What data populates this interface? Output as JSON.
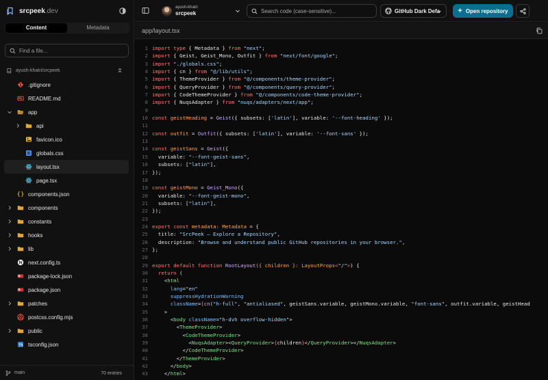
{
  "brand": {
    "name": "srcpeek",
    "tld": ".dev"
  },
  "sidebar": {
    "tabs": [
      {
        "label": "Content",
        "active": true
      },
      {
        "label": "Metadata",
        "active": false
      }
    ],
    "find_placeholder": "Find a file...",
    "repo_path": "ayush-khatri/srcpeek",
    "tree": [
      {
        "label": ".gitignore",
        "icon": "git-icon",
        "kind": "file",
        "indent": 0
      },
      {
        "label": "README.md",
        "icon": "markdown-icon",
        "kind": "file",
        "indent": 0
      },
      {
        "label": "app",
        "icon": "folder-open-icon",
        "kind": "folder-open",
        "indent": 0
      },
      {
        "label": "api",
        "icon": "folder-icon",
        "kind": "folder",
        "indent": 1
      },
      {
        "label": "favicon.ico",
        "icon": "image-icon",
        "kind": "file",
        "indent": 1
      },
      {
        "label": "globals.css",
        "icon": "css-icon",
        "kind": "file",
        "indent": 1
      },
      {
        "label": "layout.tsx",
        "icon": "react-icon",
        "kind": "file",
        "indent": 1,
        "selected": true
      },
      {
        "label": "page.tsx",
        "icon": "react-icon",
        "kind": "file",
        "indent": 1
      },
      {
        "label": "components.json",
        "icon": "json-icon",
        "kind": "file",
        "indent": 0
      },
      {
        "label": "components",
        "icon": "folder-icon",
        "kind": "folder",
        "indent": 0
      },
      {
        "label": "constants",
        "icon": "folder-icon",
        "kind": "folder",
        "indent": 0
      },
      {
        "label": "hooks",
        "icon": "folder-icon",
        "kind": "folder",
        "indent": 0
      },
      {
        "label": "lib",
        "icon": "folder-icon",
        "kind": "folder",
        "indent": 0
      },
      {
        "label": "next.config.ts",
        "icon": "next-icon",
        "kind": "file",
        "indent": 0
      },
      {
        "label": "package-lock.json",
        "icon": "npm-icon",
        "kind": "file",
        "indent": 0
      },
      {
        "label": "package.json",
        "icon": "npm-icon",
        "kind": "file",
        "indent": 0
      },
      {
        "label": "patches",
        "icon": "folder-icon",
        "kind": "folder",
        "indent": 0
      },
      {
        "label": "postcss.config.mjs",
        "icon": "postcss-icon",
        "kind": "file",
        "indent": 0
      },
      {
        "label": "public",
        "icon": "folder-icon",
        "kind": "folder",
        "indent": 0
      },
      {
        "label": "tsconfig.json",
        "icon": "tsconfig-icon",
        "kind": "file",
        "indent": 0
      }
    ],
    "status": {
      "branch": "main",
      "entries": "70 entries"
    }
  },
  "topbar": {
    "owner": "ayush-khatri",
    "repo": "srcpeek",
    "search_placeholder": "Search code (case-sensitive)...",
    "theme_value": "GitHub Dark Default",
    "open_repo_label": "Open repository"
  },
  "editor": {
    "path": "app/layout.tsx",
    "lines": [
      [
        [
          "kw",
          "import "
        ],
        [
          "kw",
          "type "
        ],
        [
          "txt",
          "{ Metadata } "
        ],
        [
          "kw",
          "from "
        ],
        [
          "str",
          "\"next\""
        ],
        [
          "txt",
          ";"
        ]
      ],
      [
        [
          "kw",
          "import "
        ],
        [
          "txt",
          "{ Geist, Geist_Mono, Outfit } "
        ],
        [
          "kw",
          "from "
        ],
        [
          "str",
          "\"next/font/google\""
        ],
        [
          "txt",
          ";"
        ]
      ],
      [
        [
          "kw",
          "import "
        ],
        [
          "str",
          "\"./globals.css\""
        ],
        [
          "txt",
          ";"
        ]
      ],
      [
        [
          "kw",
          "import "
        ],
        [
          "txt",
          "{ cn } "
        ],
        [
          "kw",
          "from "
        ],
        [
          "str",
          "\"@/lib/utils\""
        ],
        [
          "txt",
          ";"
        ]
      ],
      [
        [
          "kw",
          "import "
        ],
        [
          "txt",
          "{ ThemeProvider } "
        ],
        [
          "kw",
          "from "
        ],
        [
          "str",
          "\"@/components/theme-provider\""
        ],
        [
          "txt",
          ";"
        ]
      ],
      [
        [
          "kw",
          "import "
        ],
        [
          "txt",
          "{ QueryProvider } "
        ],
        [
          "kw",
          "from "
        ],
        [
          "str",
          "\"@/components/query-provider\""
        ],
        [
          "txt",
          ";"
        ]
      ],
      [
        [
          "kw",
          "import "
        ],
        [
          "txt",
          "{ CodeThemeProvider } "
        ],
        [
          "kw",
          "from "
        ],
        [
          "str",
          "\"@/components/code-theme-provider\""
        ],
        [
          "txt",
          ";"
        ]
      ],
      [
        [
          "kw",
          "import "
        ],
        [
          "txt",
          "{ NuqsAdapter } "
        ],
        [
          "kw",
          "from "
        ],
        [
          "str",
          "\"nuqs/adapters/next/app\""
        ],
        [
          "txt",
          ";"
        ]
      ],
      [],
      [
        [
          "kw",
          "const "
        ],
        [
          "var",
          "geistHeading"
        ],
        [
          "txt",
          " = "
        ],
        [
          "fn",
          "Geist"
        ],
        [
          "txt",
          "({ subsets: ["
        ],
        [
          "str",
          "'latin'"
        ],
        [
          "txt",
          "], variable: "
        ],
        [
          "str",
          "'--font-heading'"
        ],
        [
          "txt",
          " });"
        ]
      ],
      [],
      [
        [
          "kw",
          "const "
        ],
        [
          "var",
          "outfit"
        ],
        [
          "txt",
          " = "
        ],
        [
          "fn",
          "Outfit"
        ],
        [
          "txt",
          "({ subsets: ["
        ],
        [
          "str",
          "'latin'"
        ],
        [
          "txt",
          "], variable: "
        ],
        [
          "str",
          "'--font-sans'"
        ],
        [
          "txt",
          " });"
        ]
      ],
      [],
      [
        [
          "kw",
          "const "
        ],
        [
          "var",
          "geistSans"
        ],
        [
          "txt",
          " = "
        ],
        [
          "fn",
          "Geist"
        ],
        [
          "txt",
          "({"
        ]
      ],
      [
        [
          "txt",
          "  variable: "
        ],
        [
          "str",
          "\"--font-geist-sans\""
        ],
        [
          "txt",
          ","
        ]
      ],
      [
        [
          "txt",
          "  subsets: ["
        ],
        [
          "str",
          "\"latin\""
        ],
        [
          "txt",
          "],"
        ]
      ],
      [
        [
          "txt",
          "});"
        ]
      ],
      [],
      [
        [
          "kw",
          "const "
        ],
        [
          "var",
          "geistMono"
        ],
        [
          "txt",
          " = "
        ],
        [
          "fn",
          "Geist_Mono"
        ],
        [
          "txt",
          "({"
        ]
      ],
      [
        [
          "txt",
          "  variable: "
        ],
        [
          "str",
          "\"--font-geist-mono\""
        ],
        [
          "txt",
          ","
        ]
      ],
      [
        [
          "txt",
          "  subsets: ["
        ],
        [
          "str",
          "\"latin\""
        ],
        [
          "txt",
          "],"
        ]
      ],
      [
        [
          "txt",
          "});"
        ]
      ],
      [],
      [
        [
          "kw",
          "export "
        ],
        [
          "kw",
          "const "
        ],
        [
          "var",
          "metadata"
        ],
        [
          "kw",
          ": "
        ],
        [
          "ty",
          "Metadata"
        ],
        [
          "txt",
          " = {"
        ]
      ],
      [
        [
          "txt",
          "  title: "
        ],
        [
          "str",
          "\"SrcPeek — Explore a Repository\""
        ],
        [
          "txt",
          ","
        ]
      ],
      [
        [
          "txt",
          "  description: "
        ],
        [
          "str",
          "\"Browse and understand public GitHub repositories in your browser.\""
        ],
        [
          "txt",
          ","
        ]
      ],
      [
        [
          "txt",
          "};"
        ]
      ],
      [],
      [
        [
          "kw",
          "export "
        ],
        [
          "kw",
          "default "
        ],
        [
          "kw",
          "function "
        ],
        [
          "fn",
          "RootLayout"
        ],
        [
          "var",
          "({ children }"
        ],
        [
          "kw",
          ": "
        ],
        [
          "ty",
          "LayoutProps"
        ],
        [
          "kw",
          "<"
        ],
        [
          "str",
          "\"/\""
        ],
        [
          "kw",
          ">"
        ],
        [
          "txt",
          ") {"
        ]
      ],
      [
        [
          "kw",
          "  return "
        ],
        [
          "txt",
          "("
        ]
      ],
      [
        [
          "txt",
          "    <"
        ],
        [
          "tag",
          "html"
        ]
      ],
      [
        [
          "attr",
          "      lang"
        ],
        [
          "txt",
          "="
        ],
        [
          "str",
          "\"en\""
        ]
      ],
      [
        [
          "attr",
          "      suppressHydrationWarning"
        ]
      ],
      [
        [
          "attr",
          "      className"
        ],
        [
          "txt",
          "="
        ],
        [
          "kw",
          "{"
        ],
        [
          "fn",
          "cn"
        ],
        [
          "txt",
          "("
        ],
        [
          "str",
          "\"h-full\""
        ],
        [
          "txt",
          ", "
        ],
        [
          "str",
          "\"antialiased\""
        ],
        [
          "txt",
          ", geistSans.variable, geistMono.variable, "
        ],
        [
          "str",
          "\"font-sans\""
        ],
        [
          "txt",
          ", outfit.variable, geistHead"
        ]
      ],
      [
        [
          "txt",
          "    >"
        ]
      ],
      [
        [
          "txt",
          "      <"
        ],
        [
          "tag",
          "body "
        ],
        [
          "attr",
          "className"
        ],
        [
          "txt",
          "="
        ],
        [
          "str",
          "\"h-dvh overflow-hidden\""
        ],
        [
          "txt",
          ">"
        ]
      ],
      [
        [
          "txt",
          "        <"
        ],
        [
          "tag",
          "ThemeProvider"
        ],
        [
          "txt",
          ">"
        ]
      ],
      [
        [
          "txt",
          "          <"
        ],
        [
          "tag",
          "CodeThemeProvider"
        ],
        [
          "txt",
          ">"
        ]
      ],
      [
        [
          "txt",
          "            <"
        ],
        [
          "tag",
          "NuqsAdapter"
        ],
        [
          "txt",
          "><"
        ],
        [
          "tag",
          "QueryProvider"
        ],
        [
          "txt",
          ">"
        ],
        [
          "kw",
          "{"
        ],
        [
          "txt",
          "children"
        ],
        [
          "kw",
          "}"
        ],
        [
          "txt",
          "</"
        ],
        [
          "tag",
          "QueryProvider"
        ],
        [
          "txt",
          "></"
        ],
        [
          "tag",
          "NuqsAdapter"
        ],
        [
          "txt",
          ">"
        ]
      ],
      [
        [
          "txt",
          "          </"
        ],
        [
          "tag",
          "CodeThemeProvider"
        ],
        [
          "txt",
          ">"
        ]
      ],
      [
        [
          "txt",
          "        </"
        ],
        [
          "tag",
          "ThemeProvider"
        ],
        [
          "txt",
          ">"
        ]
      ],
      [
        [
          "txt",
          "      </"
        ],
        [
          "tag",
          "body"
        ],
        [
          "txt",
          ">"
        ]
      ],
      [
        [
          "txt",
          "    </"
        ],
        [
          "tag",
          "html"
        ],
        [
          "txt",
          ">"
        ]
      ]
    ]
  }
}
